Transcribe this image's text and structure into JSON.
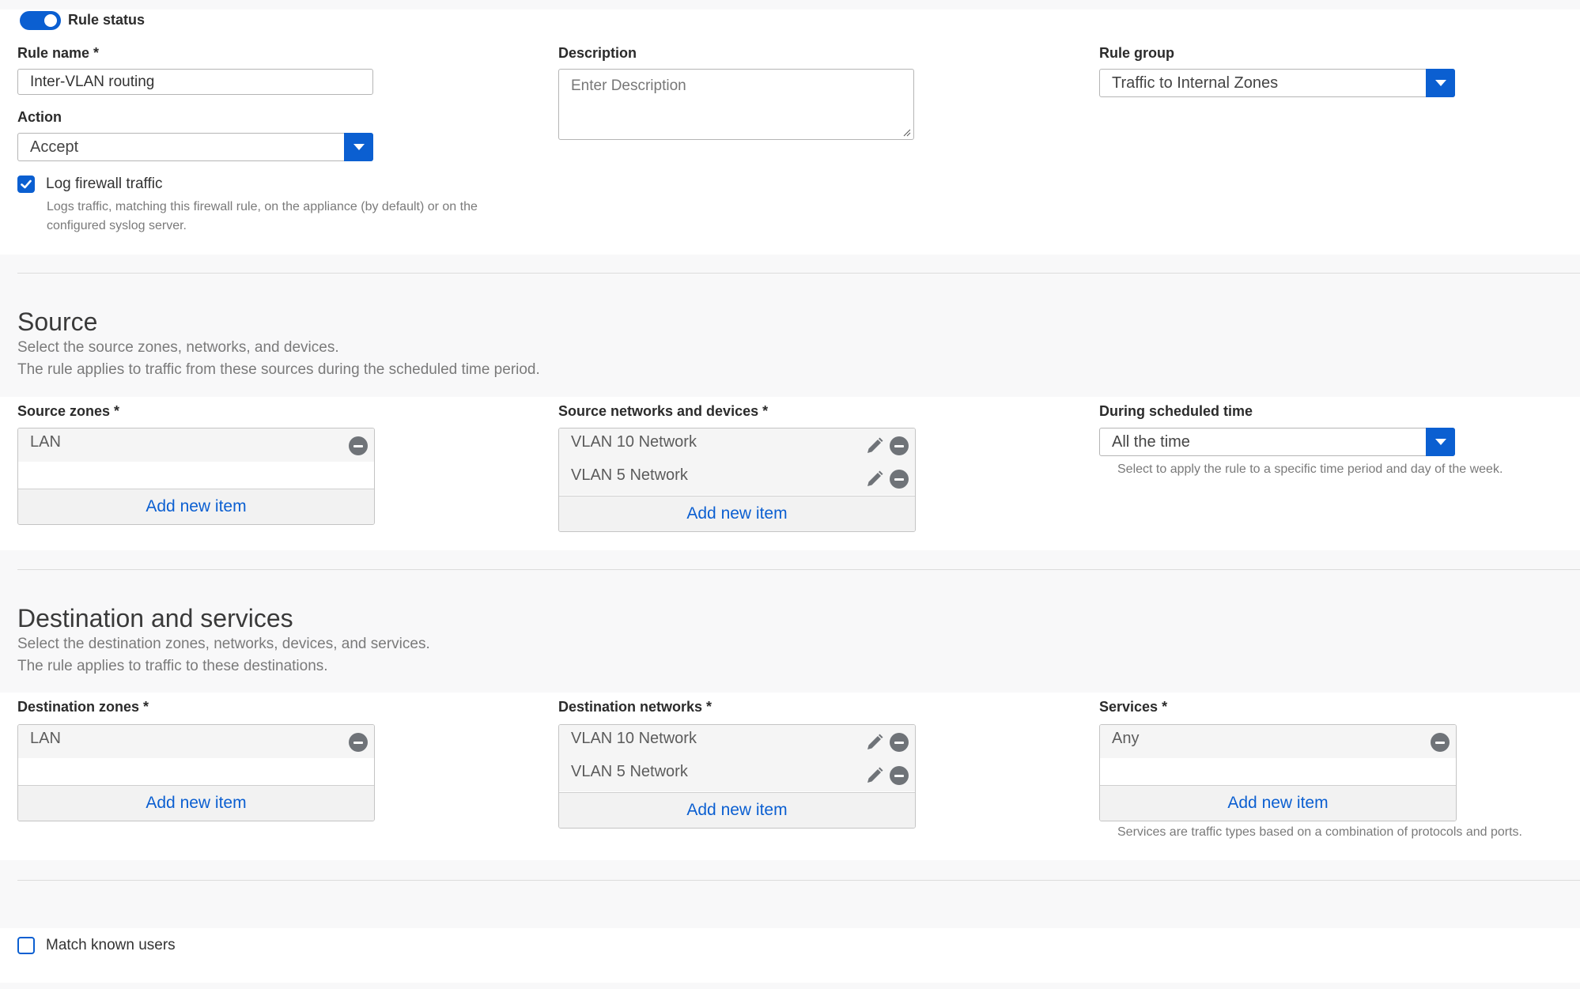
{
  "general": {
    "rule_status_label": "Rule status",
    "rule_status_on": true,
    "rule_name_label": "Rule name *",
    "rule_name_value": "Inter-VLAN routing",
    "description_label": "Description",
    "description_placeholder": "Enter Description",
    "rule_group_label": "Rule group",
    "rule_group_value": "Traffic to Internal Zones",
    "action_label": "Action",
    "action_value": "Accept",
    "log_label": "Log firewall traffic",
    "log_checked": true,
    "log_help_line1": "Logs traffic, matching this firewall rule, on the appliance (by default) or on the",
    "log_help_line2": "configured syslog server."
  },
  "source": {
    "title": "Source",
    "desc_line1": "Select the source zones, networks, and devices.",
    "desc_line2": "The rule applies to traffic from these sources during the scheduled time period.",
    "zones_label": "Source zones *",
    "zones": [
      "LAN"
    ],
    "networks_label": "Source networks and devices *",
    "networks": [
      "VLAN 10 Network",
      "VLAN 5 Network"
    ],
    "schedule_label": "During scheduled time",
    "schedule_value": "All the time",
    "schedule_help": "Select to apply the rule to a specific time period and day of the week.",
    "add_item": "Add new item"
  },
  "destination": {
    "title": "Destination and services",
    "desc_line1": "Select the destination zones, networks, devices, and services.",
    "desc_line2": "The rule applies to traffic to these destinations.",
    "zones_label": "Destination zones *",
    "zones": [
      "LAN"
    ],
    "networks_label": "Destination networks *",
    "networks": [
      "VLAN 10 Network",
      "VLAN 5 Network"
    ],
    "services_label": "Services *",
    "services": [
      "Any"
    ],
    "services_help": "Services are traffic types based on a combination of protocols and ports.",
    "add_item": "Add new item"
  },
  "users": {
    "match_known_label": "Match known users",
    "match_known_checked": false
  },
  "colors": {
    "accent": "#0b5fd1",
    "link": "#0b5fd1",
    "icon_gray": "#6f7378"
  }
}
